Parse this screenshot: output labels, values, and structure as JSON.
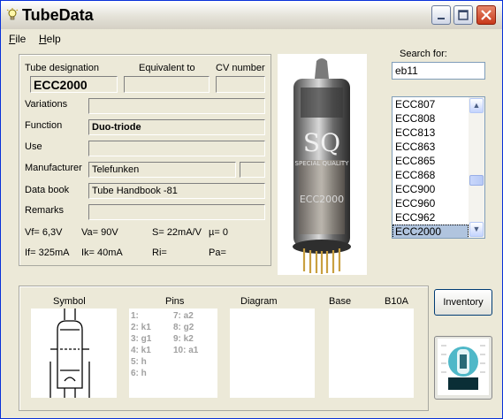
{
  "window": {
    "title": "TubeData"
  },
  "menu": {
    "file_hotkey": "F",
    "file_rest": "ile",
    "help_hotkey": "H",
    "help_rest": "elp"
  },
  "info": {
    "tube_designation_label": "Tube designation",
    "equivalent_label": "Equivalent to",
    "cv_label": "CV number",
    "tube_designation": "ECC2000",
    "equivalent": "",
    "cv_number": "",
    "variations_label": "Variations",
    "variations": "",
    "function_label": "Function",
    "function": "Duo-triode",
    "use_label": "Use",
    "use": "",
    "manufacturer_label": "Manufacturer",
    "manufacturer": "Telefunken",
    "manufacturer_code": "",
    "databook_label": "Data book",
    "databook": "Tube Handbook -81",
    "remarks_label": "Remarks",
    "remarks": "",
    "vf": "Vf= 6,3V",
    "va": "Va=  90V",
    "s": "S= 22mA/V",
    "mu": "µ=    0",
    "if": "If= 325mA",
    "ik": "Ik=   40mA",
    "ri": "Ri=",
    "pa": "Pa="
  },
  "photo": {
    "brand": "SQ",
    "subtitle": "SPECIAL QUALITY",
    "type_print": "ECC2000"
  },
  "search": {
    "label": "Search for:",
    "value": "eb11"
  },
  "tube_list": {
    "items": [
      "ECC807",
      "ECC808",
      "ECC813",
      "ECC863",
      "ECC865",
      "ECC868",
      "ECC900",
      "ECC960",
      "ECC962",
      "ECC2000"
    ],
    "selected": "ECC2000"
  },
  "bottom": {
    "symbol_label": "Symbol",
    "pins_label": "Pins",
    "diagram_label": "Diagram",
    "base_label": "Base",
    "base_value": "B10A",
    "pins_left": [
      "1:",
      "2: k1",
      "3: g1",
      "4: k1",
      "5: h",
      "6: h"
    ],
    "pins_right": [
      "7: a2",
      "8: g2",
      "9: k2",
      "10: a1"
    ]
  },
  "buttons": {
    "inventory": "Inventory"
  },
  "colors": {
    "titlebar_text": "#000000",
    "close_button": "#c8381b",
    "selection": "#b0c4de",
    "pin_text": "#a0a0a0"
  }
}
